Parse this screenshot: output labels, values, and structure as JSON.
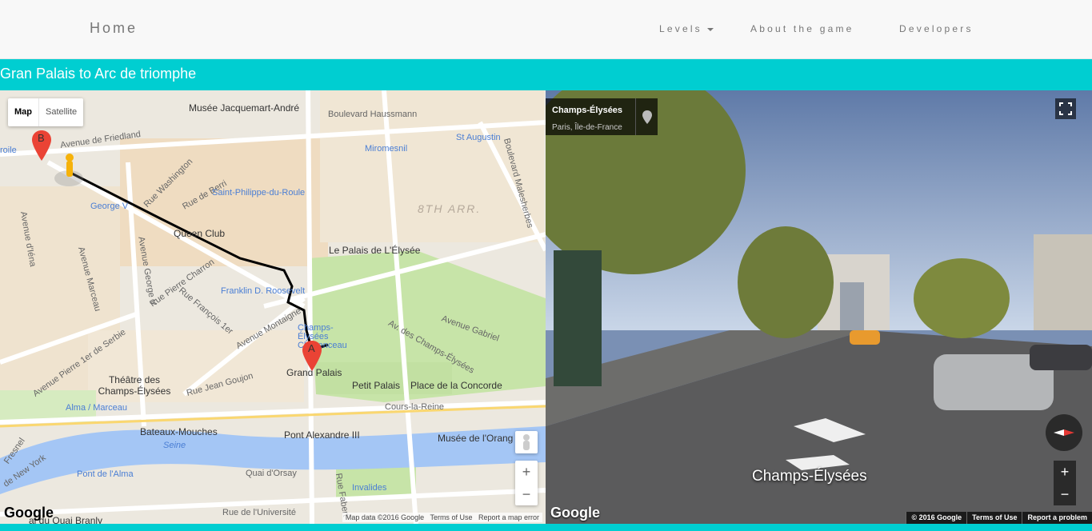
{
  "nav": {
    "brand": "Home",
    "levels": "Levels",
    "about": "About the game",
    "developers": "Developers"
  },
  "level_title": "Gran Palais to Arc de triomphe",
  "map": {
    "type_map": "Map",
    "type_satellite": "Satellite",
    "labels": {
      "musee_jacquemart": "Musée Jacquemart-André",
      "blvd_haussmann": "Boulevard Haussmann",
      "avenue_friedland": "Avenue de Friedland",
      "miromesnil": "Miromesnil",
      "st_augustin": "St Augustin",
      "blvd_malesherbes": "Boulevard Malesherbes",
      "rue_washington": "Rue Washington",
      "rue_de_berri": "Rue de Berri",
      "saint_philippe": "Saint-Philippe-du-Roule",
      "george_v": "George V",
      "arr8": "8TH ARR.",
      "queen_club": "Queen Club",
      "palais_elysee": "Le Palais de L'Élysée",
      "avenue_iena": "Avenue d'Iéna",
      "avenue_marceau": "Avenue Marceau",
      "rue_pierre_charron": "Rue Pierre Charron",
      "avenue_george_v": "Avenue George V",
      "franklin": "Franklin D. Roosevelt",
      "rue_francois": "Rue François 1er",
      "avenue_montaigne": "Avenue Montaigne",
      "champs_clemenceau": "Champs-Élysées Clemenceau",
      "av_champs": "Av. des Champs-Élysées",
      "avenue_gabriel": "Avenue Gabriel",
      "avenue_serbie": "Avenue Pierre 1er de Serbie",
      "grand_palais": "Grand Palais",
      "theatre": "Théâtre des Champs-Élysées",
      "rue_jean_goujon": "Rue Jean Goujon",
      "petit_palais": "Petit Palais",
      "place_concorde": "Place de la Concorde",
      "alma": "Alma / Marceau",
      "cours_reine": "Cours-la-Reine",
      "bateaux": "Bateaux-Mouches",
      "seine": "Seine",
      "pont_alexandre": "Pont Alexandre III",
      "musee_orangerie": "Musée de l'Orang",
      "pont_alma": "Pont de l'Alma",
      "quai_orsay": "Quai d'Orsay",
      "invalides": "Invalides",
      "rue_fabert": "Rue Fabert",
      "rue_universite": "Rue de l'Université",
      "ny": "de New York",
      "fresnel": "Fresnel",
      "branly": "ai du Quai Branly",
      "roile": "roile",
      "marker_a": "A",
      "marker_b": "B"
    },
    "zoom_in": "+",
    "zoom_out": "−",
    "google": "Google",
    "footer": {
      "data": "Map data ©2016 Google",
      "terms": "Terms of Use",
      "report": "Report a map error"
    }
  },
  "streetview": {
    "place": "Champs-Élysées",
    "region": "Paris, Île-de-France",
    "street_label": "Champs-Élysées",
    "google": "Google",
    "zoom_in": "+",
    "zoom_out": "−",
    "footer": {
      "copyright": "© 2016 Google",
      "terms": "Terms of Use",
      "report": "Report a problem"
    }
  }
}
